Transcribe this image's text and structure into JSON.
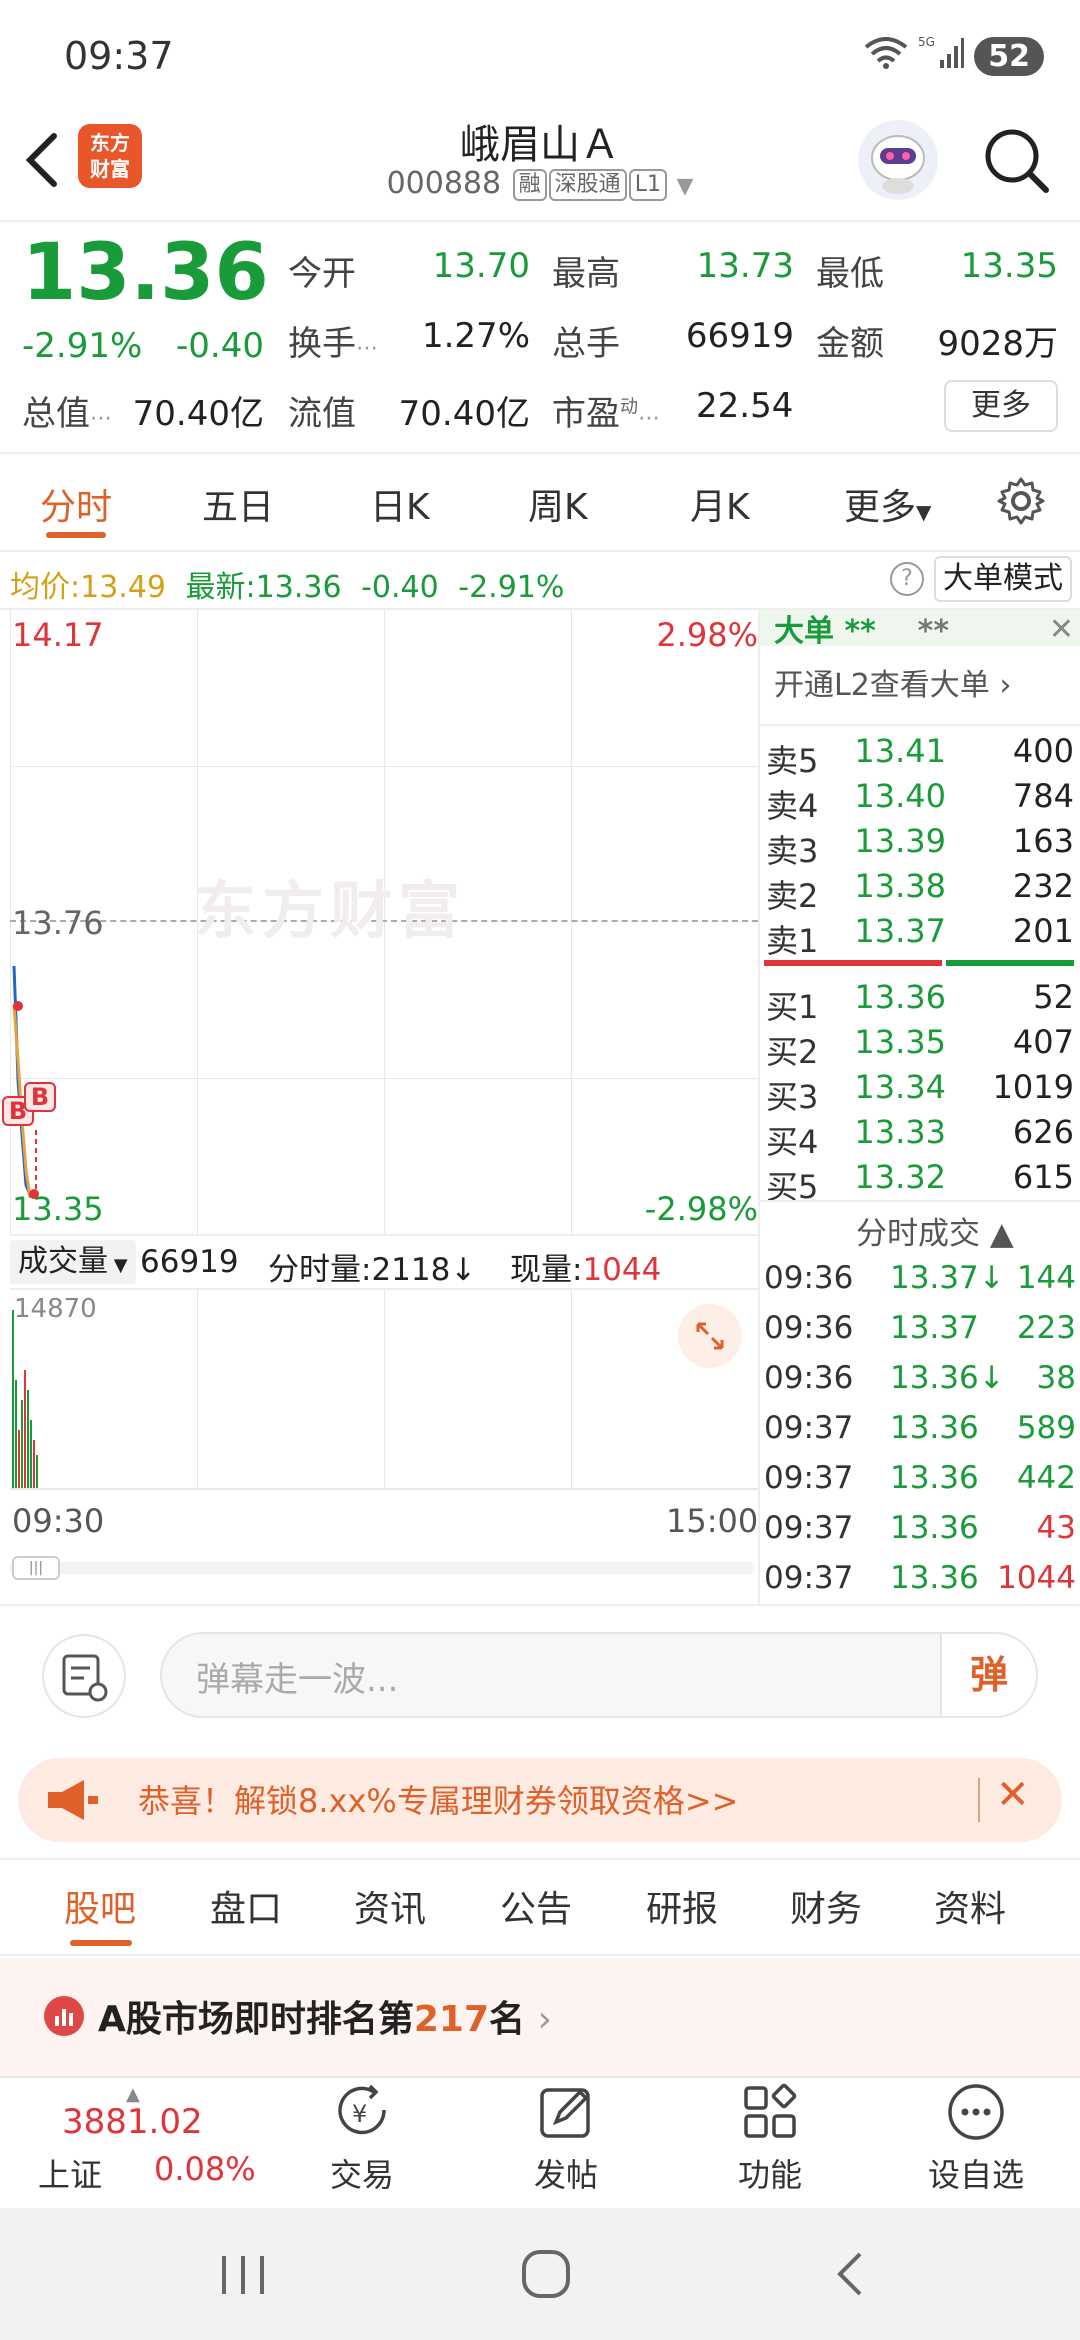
{
  "status": {
    "time": "09:37",
    "battery": "52",
    "net": "5G"
  },
  "header": {
    "logo_text": "东方\n财富",
    "stock_name": "峨眉山Ａ",
    "code": "000888",
    "tags": [
      "融",
      "深股通",
      "L1"
    ]
  },
  "quote": {
    "price": "13.36",
    "pct": "-2.91%",
    "chg": "-0.40",
    "open_label": "今开",
    "open": "13.70",
    "high_label": "最高",
    "high": "13.73",
    "low_label": "最低",
    "low": "13.35",
    "turnover_label": "换手",
    "turnover": "1.27%",
    "volume_label": "总手",
    "volume": "66919",
    "amount_label": "金额",
    "amount": "9028万",
    "mktcap_label": "总值",
    "mktcap": "70.40亿",
    "float_label": "流值",
    "float": "70.40亿",
    "pe_label": "市盈",
    "pe_sup": "动",
    "pe": "22.54",
    "more": "更多"
  },
  "tabs": [
    "分时",
    "五日",
    "日K",
    "周K",
    "月K",
    "更多"
  ],
  "infobar": {
    "avg_label": "均价:",
    "avg": "13.49",
    "last_label": "最新:",
    "last": "13.36",
    "chg": "-0.40",
    "pct": "-2.91%",
    "mode": "大单模式"
  },
  "chart": {
    "top_price": "14.17",
    "top_pct": "2.98%",
    "mid_price": "13.76",
    "bottom_price": "13.35",
    "bottom_pct": "-2.98%",
    "watermark": "东方财富",
    "vol_max": "14870",
    "time_start": "09:30",
    "time_end": "15:00",
    "marker": "B"
  },
  "volbar": {
    "label": "成交量",
    "total": "66919",
    "fenshi_label": "分时量:",
    "fenshi": "2118↓",
    "now_label": "现量:",
    "now": "1044"
  },
  "bigorder": {
    "title": "大单",
    "stars": "**",
    "stars2": "**",
    "link": "开通L2查看大单 ›"
  },
  "orderbook": {
    "asks": [
      {
        "l": "卖5",
        "p": "13.41",
        "v": "400"
      },
      {
        "l": "卖4",
        "p": "13.40",
        "v": "784"
      },
      {
        "l": "卖3",
        "p": "13.39",
        "v": "163"
      },
      {
        "l": "卖2",
        "p": "13.38",
        "v": "232"
      },
      {
        "l": "卖1",
        "p": "13.37",
        "v": "201"
      }
    ],
    "bids": [
      {
        "l": "买1",
        "p": "13.36",
        "v": "52"
      },
      {
        "l": "买2",
        "p": "13.35",
        "v": "407"
      },
      {
        "l": "买3",
        "p": "13.34",
        "v": "1019"
      },
      {
        "l": "买4",
        "p": "13.33",
        "v": "626"
      },
      {
        "l": "买5",
        "p": "13.32",
        "v": "615"
      }
    ]
  },
  "trades": {
    "title": "分时成交",
    "rows": [
      {
        "t": "09:36",
        "p": "13.37↓",
        "v": "144"
      },
      {
        "t": "09:36",
        "p": "13.37",
        "v": "223"
      },
      {
        "t": "09:36",
        "p": "13.36↓",
        "v": "38"
      },
      {
        "t": "09:37",
        "p": "13.36",
        "v": "589"
      },
      {
        "t": "09:37",
        "p": "13.36",
        "v": "442"
      },
      {
        "t": "09:37",
        "p": "13.36",
        "v": "43"
      },
      {
        "t": "09:37",
        "p": "13.36",
        "v": "1044"
      }
    ],
    "vol_colors": [
      "green",
      "green",
      "green",
      "green",
      "green",
      "red",
      "red"
    ]
  },
  "danmu": {
    "placeholder": "弹幕走一波...",
    "send": "弹"
  },
  "promo": {
    "text": "恭喜！解锁8.xx%专属理财券领取资格>>"
  },
  "bottom_tabs": [
    "股吧",
    "盘口",
    "资讯",
    "公告",
    "研报",
    "财务",
    "资料"
  ],
  "rank": {
    "pre": "A股市场即时排名第",
    "num": "217",
    "post": "名"
  },
  "index": {
    "value": "3881.02",
    "name": "上证",
    "pct": "0.08%"
  },
  "nav": [
    "交易",
    "发帖",
    "功能",
    "设自选"
  ],
  "colors": {
    "up": "#e0333a",
    "down": "#1a9b3a",
    "accent": "#e0602a"
  }
}
